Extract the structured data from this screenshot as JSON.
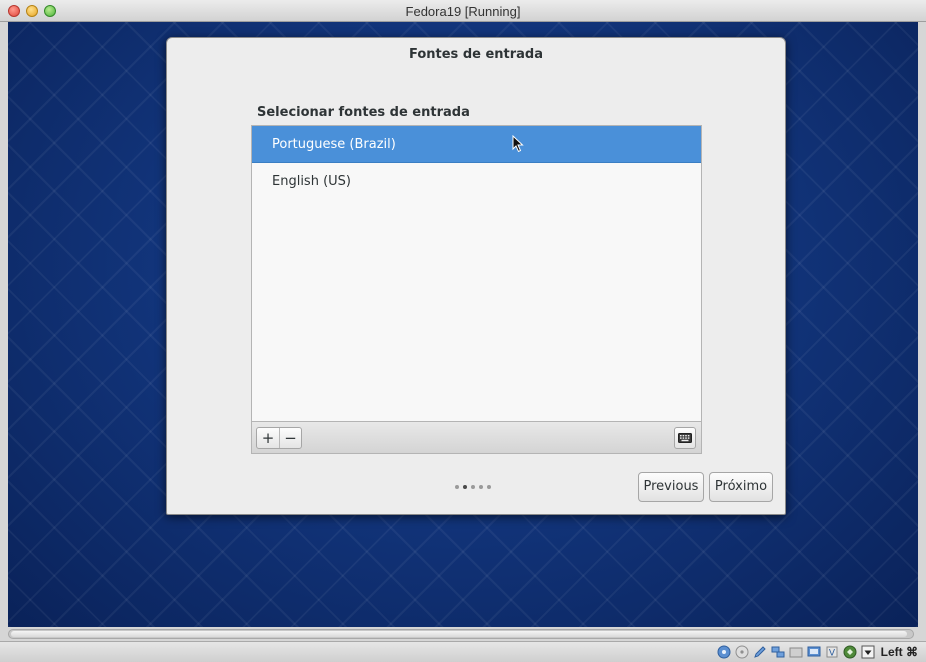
{
  "host_window": {
    "title": "Fedora19 [Running]",
    "host_key_label": "Left ⌘"
  },
  "dialog": {
    "title": "Fontes de entrada",
    "section_label": "Selecionar fontes de entrada",
    "input_sources": [
      {
        "label": "Portuguese (Brazil)",
        "selected": true
      },
      {
        "label": "English (US)",
        "selected": false
      }
    ],
    "toolbar": {
      "add_label": "+",
      "remove_label": "−"
    },
    "page_dots": {
      "count": 5,
      "active_index": 1
    },
    "buttons": {
      "previous_label": "Previous",
      "next_label": "Próximo"
    }
  },
  "status_icons": [
    "hard-disk-icon",
    "optical-disk-icon",
    "pen-icon",
    "network-icon",
    "folder-icon",
    "display-icon",
    "capture-icon",
    "mouse-integration-icon"
  ],
  "colors": {
    "selection": "#4a90d9",
    "desktop": "#12357c",
    "dialog_bg": "#ededed"
  }
}
